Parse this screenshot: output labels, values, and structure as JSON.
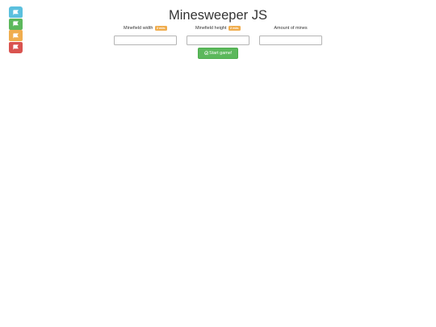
{
  "sidebar": {
    "buttons": [
      {
        "icon": "flag-icon",
        "color": "#5bc0de"
      },
      {
        "icon": "flag-icon",
        "color": "#5cb85c"
      },
      {
        "icon": "flag-icon",
        "color": "#f0ad4e"
      },
      {
        "icon": "flag-icon",
        "color": "#d9534f"
      }
    ]
  },
  "header": {
    "title": "Minesweeper JS"
  },
  "form": {
    "width": {
      "label": "Minefield width",
      "badge": "2 min.",
      "value": ""
    },
    "height": {
      "label": "Minefield height",
      "badge": "2 min.",
      "value": ""
    },
    "mines": {
      "label": "Amount of mines",
      "value": ""
    },
    "start_label": "Start game!"
  },
  "colors": {
    "badge": "#f0ad4e",
    "start_button": "#5cb85c"
  }
}
